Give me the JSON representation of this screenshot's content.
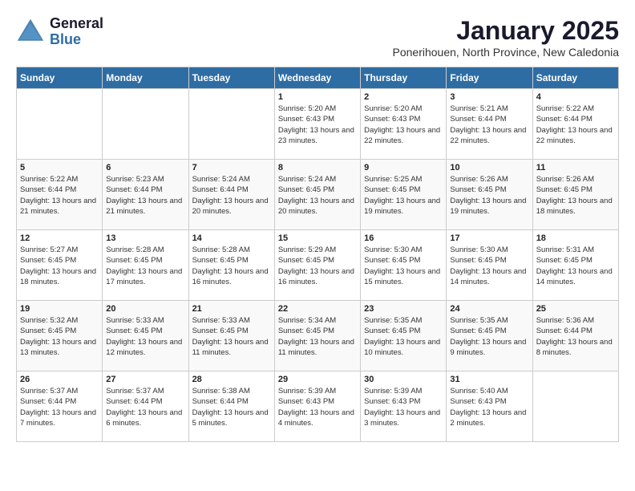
{
  "logo": {
    "line1": "General",
    "line2": "Blue"
  },
  "title": "January 2025",
  "subtitle": "Ponerihouen, North Province, New Caledonia",
  "days_of_week": [
    "Sunday",
    "Monday",
    "Tuesday",
    "Wednesday",
    "Thursday",
    "Friday",
    "Saturday"
  ],
  "weeks": [
    [
      {
        "day": "",
        "sunrise": "",
        "sunset": "",
        "daylight": ""
      },
      {
        "day": "",
        "sunrise": "",
        "sunset": "",
        "daylight": ""
      },
      {
        "day": "",
        "sunrise": "",
        "sunset": "",
        "daylight": ""
      },
      {
        "day": "1",
        "sunrise": "Sunrise: 5:20 AM",
        "sunset": "Sunset: 6:43 PM",
        "daylight": "Daylight: 13 hours and 23 minutes."
      },
      {
        "day": "2",
        "sunrise": "Sunrise: 5:20 AM",
        "sunset": "Sunset: 6:43 PM",
        "daylight": "Daylight: 13 hours and 22 minutes."
      },
      {
        "day": "3",
        "sunrise": "Sunrise: 5:21 AM",
        "sunset": "Sunset: 6:44 PM",
        "daylight": "Daylight: 13 hours and 22 minutes."
      },
      {
        "day": "4",
        "sunrise": "Sunrise: 5:22 AM",
        "sunset": "Sunset: 6:44 PM",
        "daylight": "Daylight: 13 hours and 22 minutes."
      }
    ],
    [
      {
        "day": "5",
        "sunrise": "Sunrise: 5:22 AM",
        "sunset": "Sunset: 6:44 PM",
        "daylight": "Daylight: 13 hours and 21 minutes."
      },
      {
        "day": "6",
        "sunrise": "Sunrise: 5:23 AM",
        "sunset": "Sunset: 6:44 PM",
        "daylight": "Daylight: 13 hours and 21 minutes."
      },
      {
        "day": "7",
        "sunrise": "Sunrise: 5:24 AM",
        "sunset": "Sunset: 6:44 PM",
        "daylight": "Daylight: 13 hours and 20 minutes."
      },
      {
        "day": "8",
        "sunrise": "Sunrise: 5:24 AM",
        "sunset": "Sunset: 6:45 PM",
        "daylight": "Daylight: 13 hours and 20 minutes."
      },
      {
        "day": "9",
        "sunrise": "Sunrise: 5:25 AM",
        "sunset": "Sunset: 6:45 PM",
        "daylight": "Daylight: 13 hours and 19 minutes."
      },
      {
        "day": "10",
        "sunrise": "Sunrise: 5:26 AM",
        "sunset": "Sunset: 6:45 PM",
        "daylight": "Daylight: 13 hours and 19 minutes."
      },
      {
        "day": "11",
        "sunrise": "Sunrise: 5:26 AM",
        "sunset": "Sunset: 6:45 PM",
        "daylight": "Daylight: 13 hours and 18 minutes."
      }
    ],
    [
      {
        "day": "12",
        "sunrise": "Sunrise: 5:27 AM",
        "sunset": "Sunset: 6:45 PM",
        "daylight": "Daylight: 13 hours and 18 minutes."
      },
      {
        "day": "13",
        "sunrise": "Sunrise: 5:28 AM",
        "sunset": "Sunset: 6:45 PM",
        "daylight": "Daylight: 13 hours and 17 minutes."
      },
      {
        "day": "14",
        "sunrise": "Sunrise: 5:28 AM",
        "sunset": "Sunset: 6:45 PM",
        "daylight": "Daylight: 13 hours and 16 minutes."
      },
      {
        "day": "15",
        "sunrise": "Sunrise: 5:29 AM",
        "sunset": "Sunset: 6:45 PM",
        "daylight": "Daylight: 13 hours and 16 minutes."
      },
      {
        "day": "16",
        "sunrise": "Sunrise: 5:30 AM",
        "sunset": "Sunset: 6:45 PM",
        "daylight": "Daylight: 13 hours and 15 minutes."
      },
      {
        "day": "17",
        "sunrise": "Sunrise: 5:30 AM",
        "sunset": "Sunset: 6:45 PM",
        "daylight": "Daylight: 13 hours and 14 minutes."
      },
      {
        "day": "18",
        "sunrise": "Sunrise: 5:31 AM",
        "sunset": "Sunset: 6:45 PM",
        "daylight": "Daylight: 13 hours and 14 minutes."
      }
    ],
    [
      {
        "day": "19",
        "sunrise": "Sunrise: 5:32 AM",
        "sunset": "Sunset: 6:45 PM",
        "daylight": "Daylight: 13 hours and 13 minutes."
      },
      {
        "day": "20",
        "sunrise": "Sunrise: 5:33 AM",
        "sunset": "Sunset: 6:45 PM",
        "daylight": "Daylight: 13 hours and 12 minutes."
      },
      {
        "day": "21",
        "sunrise": "Sunrise: 5:33 AM",
        "sunset": "Sunset: 6:45 PM",
        "daylight": "Daylight: 13 hours and 11 minutes."
      },
      {
        "day": "22",
        "sunrise": "Sunrise: 5:34 AM",
        "sunset": "Sunset: 6:45 PM",
        "daylight": "Daylight: 13 hours and 11 minutes."
      },
      {
        "day": "23",
        "sunrise": "Sunrise: 5:35 AM",
        "sunset": "Sunset: 6:45 PM",
        "daylight": "Daylight: 13 hours and 10 minutes."
      },
      {
        "day": "24",
        "sunrise": "Sunrise: 5:35 AM",
        "sunset": "Sunset: 6:45 PM",
        "daylight": "Daylight: 13 hours and 9 minutes."
      },
      {
        "day": "25",
        "sunrise": "Sunrise: 5:36 AM",
        "sunset": "Sunset: 6:44 PM",
        "daylight": "Daylight: 13 hours and 8 minutes."
      }
    ],
    [
      {
        "day": "26",
        "sunrise": "Sunrise: 5:37 AM",
        "sunset": "Sunset: 6:44 PM",
        "daylight": "Daylight: 13 hours and 7 minutes."
      },
      {
        "day": "27",
        "sunrise": "Sunrise: 5:37 AM",
        "sunset": "Sunset: 6:44 PM",
        "daylight": "Daylight: 13 hours and 6 minutes."
      },
      {
        "day": "28",
        "sunrise": "Sunrise: 5:38 AM",
        "sunset": "Sunset: 6:44 PM",
        "daylight": "Daylight: 13 hours and 5 minutes."
      },
      {
        "day": "29",
        "sunrise": "Sunrise: 5:39 AM",
        "sunset": "Sunset: 6:43 PM",
        "daylight": "Daylight: 13 hours and 4 minutes."
      },
      {
        "day": "30",
        "sunrise": "Sunrise: 5:39 AM",
        "sunset": "Sunset: 6:43 PM",
        "daylight": "Daylight: 13 hours and 3 minutes."
      },
      {
        "day": "31",
        "sunrise": "Sunrise: 5:40 AM",
        "sunset": "Sunset: 6:43 PM",
        "daylight": "Daylight: 13 hours and 2 minutes."
      },
      {
        "day": "",
        "sunrise": "",
        "sunset": "",
        "daylight": ""
      }
    ]
  ]
}
